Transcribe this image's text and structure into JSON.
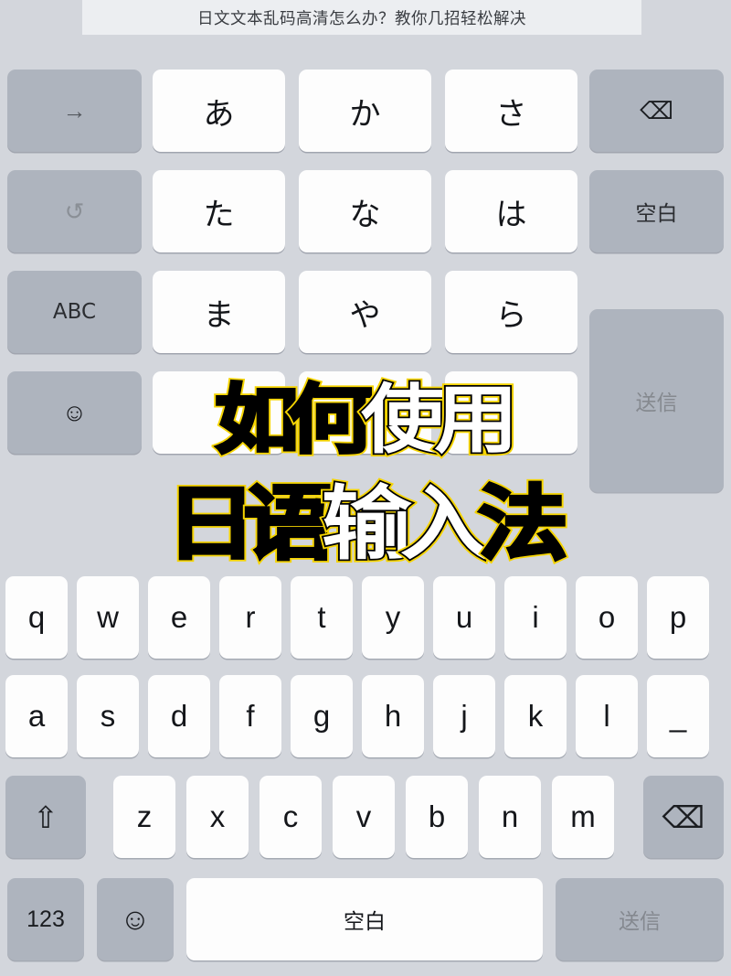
{
  "title": {
    "text": "日文文本乱码高清怎么办？教你几招轻松解决"
  },
  "overlay": {
    "line1": "如何使用",
    "line2": "日语输入法",
    "line1_chars": [
      {
        "ch": "如",
        "fill": "blk"
      },
      {
        "ch": "何",
        "fill": "blk"
      },
      {
        "ch": "使",
        "fill": "wht"
      },
      {
        "ch": "用",
        "fill": "wht"
      }
    ],
    "line2_chars": [
      {
        "ch": "日",
        "fill": "blk"
      },
      {
        "ch": "语",
        "fill": "blk"
      },
      {
        "ch": "输",
        "fill": "wht"
      },
      {
        "ch": "入",
        "fill": "wht"
      },
      {
        "ch": "法",
        "fill": "blk"
      }
    ],
    "outline_color": "#f5d400",
    "stroke_color": "#000000"
  },
  "kana_keyboard": {
    "left_column": [
      {
        "label": "→",
        "icon": "arrow-right-icon",
        "name": "kana-next-candidate-key"
      },
      {
        "label": "↺",
        "icon": "undo-icon",
        "name": "kana-undo-key"
      },
      {
        "label": "ABC",
        "icon": "",
        "name": "kana-abc-key"
      },
      {
        "label": "☺",
        "icon": "emoji-face-icon",
        "name": "kana-emoji-key"
      }
    ],
    "grid": [
      [
        "あ",
        "か",
        "さ"
      ],
      [
        "た",
        "な",
        "は"
      ],
      [
        "ま",
        "や",
        "ら"
      ],
      [
        "",
        "",
        ""
      ]
    ],
    "right_column": [
      {
        "label": "⌫",
        "icon": "delete-icon",
        "name": "kana-delete-key",
        "dim": false
      },
      {
        "label": "空白",
        "icon": "",
        "name": "kana-space-key",
        "dim": false
      }
    ],
    "send_key": {
      "label": "送信",
      "name": "kana-send-key",
      "dim": true
    }
  },
  "qwerty_keyboard": {
    "row_q": [
      "q",
      "w",
      "e",
      "r",
      "t",
      "y",
      "u",
      "i",
      "o",
      "p"
    ],
    "row_a": [
      "a",
      "s",
      "d",
      "f",
      "g",
      "h",
      "j",
      "k",
      "l",
      "_"
    ],
    "row_z": [
      "z",
      "x",
      "c",
      "v",
      "b",
      "n",
      "m"
    ],
    "shift_key": {
      "label": "⇧",
      "icon": "shift-arrow-icon",
      "name": "qwerty-shift-key"
    },
    "delete_key": {
      "label": "⌫",
      "icon": "delete-icon",
      "name": "qwerty-delete-key"
    },
    "bottom_row": {
      "numbers_key": {
        "label": "123",
        "name": "qwerty-numbers-key"
      },
      "emoji_key": {
        "label": "☺",
        "icon": "emoji-face-icon",
        "name": "qwerty-emoji-key"
      },
      "space_key": {
        "label": "空白",
        "name": "qwerty-space-key"
      },
      "send_key": {
        "label": "送信",
        "name": "qwerty-send-key",
        "dim": true
      }
    }
  },
  "colors": {
    "background": "#d3d6dc",
    "title_panel": "#eceef1",
    "function_key": "#aeb4be",
    "letter_key": "#fdfdfd",
    "accent_yellow": "#f5d400"
  }
}
